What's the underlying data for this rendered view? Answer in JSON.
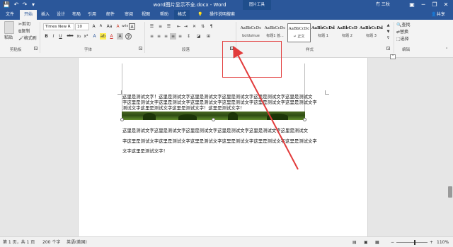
{
  "titlebar": {
    "document_title": "word图片显示不全.docx - Word",
    "context_tools": "图片工具",
    "user_name": "冇 三秋",
    "min_icon": "─",
    "restore_icon": "❐",
    "close_icon": "✕",
    "ribbon_display_icon": "▣"
  },
  "quick_access": {
    "save_icon": "💾",
    "undo_icon": "↶",
    "redo_icon": "↷",
    "more_icon": "▾"
  },
  "tabs": [
    "文件",
    "开始",
    "插入",
    "设计",
    "布局",
    "引用",
    "邮件",
    "审阅",
    "视图",
    "帮助",
    "格式"
  ],
  "tell_me": "操作说明搜索",
  "share_label": "共享",
  "clipboard": {
    "paste": "粘贴",
    "cut": "剪切",
    "copy": "复制",
    "format_painter": "格式刷",
    "group_label": "剪贴板"
  },
  "font": {
    "name": "Times New R",
    "size": "10",
    "grow": "A",
    "shrink": "A",
    "aa": "Aa",
    "clear": "A",
    "wen": "wén",
    "a_box": "A",
    "bold": "B",
    "italic": "I",
    "underline": "U",
    "strike": "abc",
    "sub": "x₂",
    "sup": "x²",
    "fx": "A",
    "highlight": "ab",
    "color": "A",
    "char_shade": "A",
    "enclose": "字",
    "group_label": "字体"
  },
  "paragraph": {
    "group_label": "段落"
  },
  "styles": {
    "items": [
      {
        "sample": "AaBbCcDc",
        "name": "bolduinue"
      },
      {
        "sample": "AaBbCcDc",
        "name": "标题1 首..."
      },
      {
        "sample": "AaBbCcDc",
        "name": "↵ 正文"
      },
      {
        "sample": "AaBbCcDd",
        "name": "标题 1"
      },
      {
        "sample": "AaBbCcD",
        "name": "标题 2"
      },
      {
        "sample": "AaBbCcDd",
        "name": "标题 3"
      }
    ],
    "group_label": "样式"
  },
  "editing": {
    "find": "查找",
    "replace": "替换",
    "select": "选择",
    "group_label": "编辑"
  },
  "document": {
    "para1": [
      "这里是测试文字！这里是测试文字这里是测试文字这里是测试文字这里是测试文字这里是测试文",
      "字这里是测试文字这里是测试文字这里是测试文字这里是测试文字这里是测试文字这里是测试文字",
      "测试文字这里是测试文字这里是测试文字！这里是测试文字！"
    ],
    "para2": [
      "这里是测试文字这里是测试文字这里是测试文字这里是测试文字这里是测试文字这里是测试文",
      "字这里是测试文字这里是测试文字这里是测试文字这里是测试文字这里是测试文字这里是测试文字",
      "文字这里是测试文字！"
    ]
  },
  "statusbar": {
    "page": "第 1 页，共 1 页",
    "words": "200 个字",
    "language": "英语(美国)",
    "zoom": "110%",
    "zoom_minus": "−",
    "zoom_plus": "+"
  },
  "annotation_color": "#e23b3b",
  "brand_color": "#2b579a"
}
